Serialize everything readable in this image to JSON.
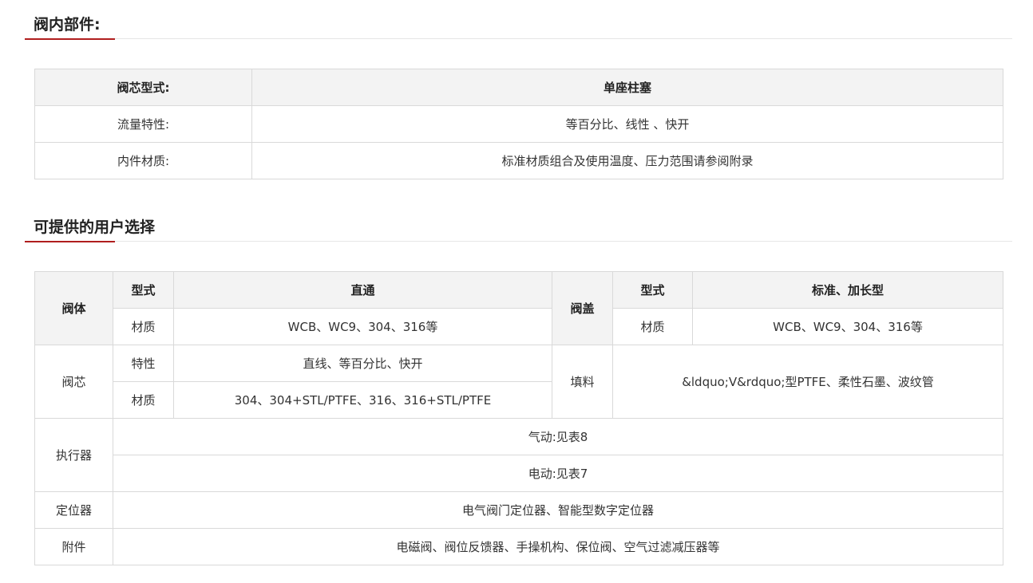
{
  "section1": {
    "title": "阀内部件:",
    "rows": [
      {
        "label": "阀芯型式:",
        "value": "单座柱塞"
      },
      {
        "label": "流量特性:",
        "value": "等百分比、线性 、快开"
      },
      {
        "label": "内件材质:",
        "value": "标准材质组合及使用温度、压力范围请参阅附录"
      }
    ]
  },
  "section2": {
    "title": "可提供的用户选择",
    "body": {
      "label": "阀体",
      "type_label": "型式",
      "type_value": "直通",
      "material_label": "材质",
      "material_value": "WCB、WC9、304、316等"
    },
    "bonnet": {
      "label": "阀盖",
      "type_label": "型式",
      "type_value": "标准、加长型",
      "material_label": "材质",
      "material_value": "WCB、WC9、304、316等"
    },
    "plug": {
      "label": "阀芯",
      "char_label": "特性",
      "char_value": "直线、等百分比、快开",
      "material_label": "材质",
      "material_value": "304、304+STL/PTFE、316、316+STL/PTFE"
    },
    "packing": {
      "label": "填料",
      "value": "&ldquo;V&rdquo;型PTFE、柔性石墨、波纹管"
    },
    "actuator": {
      "label": "执行器",
      "pneumatic": "气动:见表8",
      "electric": "电动:见表7"
    },
    "positioner": {
      "label": "定位器",
      "value": "电气阀门定位器、智能型数字定位器"
    },
    "accessories": {
      "label": "附件",
      "value": "电磁阀、阀位反馈器、手操机构、保位阀、空气过滤减压器等"
    }
  }
}
